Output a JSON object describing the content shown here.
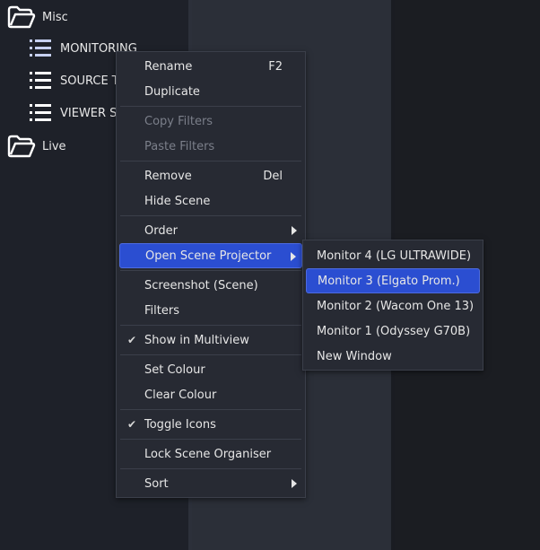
{
  "tree": {
    "items": [
      {
        "label": "Misc",
        "icon": "folder-open-icon"
      },
      {
        "label": "MONITORING",
        "icon": "list-icon"
      },
      {
        "label": "SOURCE T",
        "icon": "list-icon"
      },
      {
        "label": "VIEWER SC",
        "icon": "list-icon"
      },
      {
        "label": "Live",
        "icon": "folder-open-icon"
      }
    ]
  },
  "context_menu": {
    "items": [
      {
        "label": "Rename",
        "shortcut": "F2"
      },
      {
        "label": "Duplicate"
      },
      {
        "label": "Copy Filters",
        "disabled": true
      },
      {
        "label": "Paste Filters",
        "disabled": true
      },
      {
        "label": "Remove",
        "shortcut": "Del"
      },
      {
        "label": "Hide Scene"
      },
      {
        "label": "Order",
        "submenu": true
      },
      {
        "label": "Open Scene Projector",
        "submenu": true,
        "highlighted": true
      },
      {
        "label": "Screenshot (Scene)"
      },
      {
        "label": "Filters"
      },
      {
        "label": "Show in Multiview",
        "checked": true
      },
      {
        "label": "Set Colour"
      },
      {
        "label": "Clear Colour"
      },
      {
        "label": "Toggle Icons",
        "checked": true
      },
      {
        "label": "Lock Scene Organiser"
      },
      {
        "label": "Sort",
        "submenu": true
      }
    ]
  },
  "projector_submenu": {
    "items": [
      {
        "label": "Monitor 4 (LG ULTRAWIDE)"
      },
      {
        "label": "Monitor 3 (Elgato Prom.)",
        "highlighted": true
      },
      {
        "label": "Monitor 2 (Wacom One 13)"
      },
      {
        "label": "Monitor 1 (Odyssey G70B)"
      },
      {
        "label": "New Window"
      }
    ]
  },
  "colors": {
    "highlight": "#2b4ed1",
    "menu_bg": "#272a33",
    "icon_accent": "#c6d0f0"
  }
}
